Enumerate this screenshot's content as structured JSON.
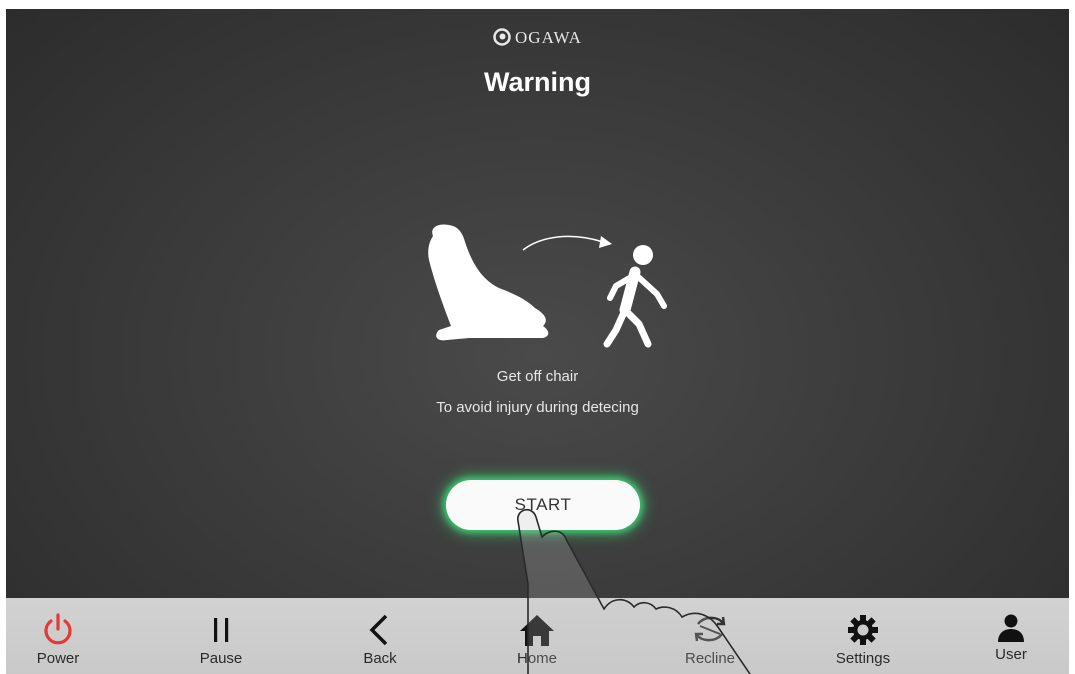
{
  "brand": {
    "name": "OGAWA"
  },
  "screen": {
    "title": "Warning"
  },
  "message": {
    "line1": "Get off chair",
    "line2": "To avoid injury during detecing"
  },
  "start_button": {
    "label": "START"
  },
  "navbar": {
    "items": [
      {
        "label": "Power",
        "icon": "power-icon",
        "color": "#e53935"
      },
      {
        "label": "Pause",
        "icon": "pause-icon"
      },
      {
        "label": "Back",
        "icon": "back-icon"
      },
      {
        "label": "Home",
        "icon": "home-icon"
      },
      {
        "label": "Recline",
        "icon": "recline-icon"
      },
      {
        "label": "Settings",
        "icon": "gear-icon"
      },
      {
        "label": "User",
        "icon": "user-icon"
      }
    ]
  },
  "colors": {
    "accent_glow": "#3fbf6f",
    "power": "#e53935",
    "background": "#3c3c3c",
    "navbar": "#cccccc"
  }
}
